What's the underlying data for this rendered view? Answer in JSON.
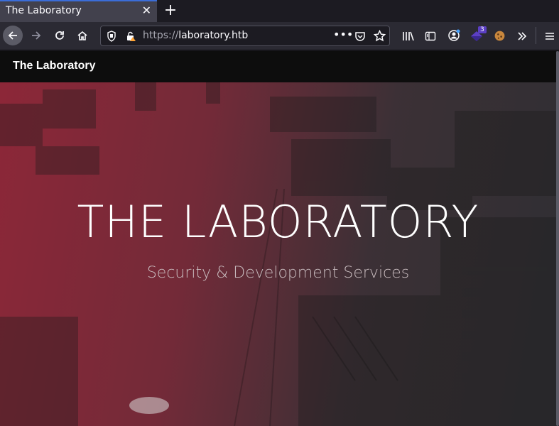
{
  "browser": {
    "tab_title": "The Laboratory",
    "tab_close": "✕",
    "new_tab": "+",
    "url_scheme": "https://",
    "url_host": "laboratory.htb",
    "badge_count": "3",
    "accent": "#3b6dd8"
  },
  "site": {
    "brand": "The Laboratory",
    "hero_title": "THE LABORATORY",
    "hero_subtitle": "Security & Development Services",
    "hero_color": "#96283a"
  }
}
